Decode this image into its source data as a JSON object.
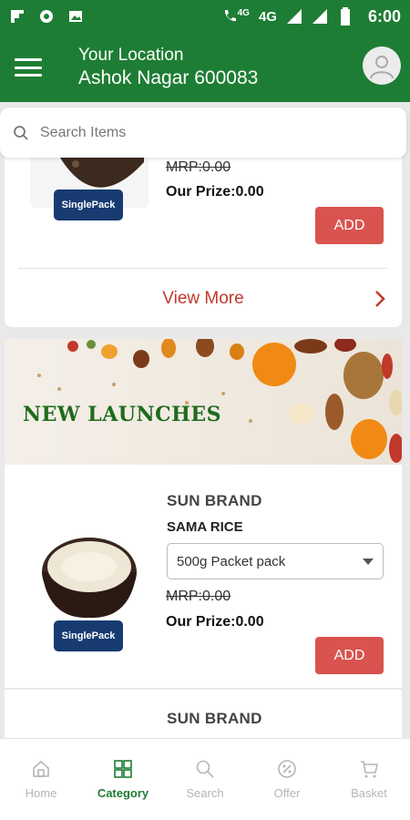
{
  "status_bar": {
    "network_label": "4G",
    "network_label_small": "4G",
    "time": "6:00"
  },
  "header": {
    "location_title": "Your Location",
    "location_name": "Ashok Nagar 600083"
  },
  "search": {
    "placeholder": "Search Items"
  },
  "card_top": {
    "pack_label": "SinglePack",
    "mrp": "MRP:0.00",
    "prize": "Our Prize:0.00",
    "add_label": "ADD",
    "view_more": "View More"
  },
  "banner": {
    "title": "NEW LAUNCHES"
  },
  "card_product": {
    "brand": "SUN BRAND",
    "name": "SAMA RICE",
    "variant": "500g Packet pack",
    "pack_label": "SinglePack",
    "mrp": "MRP:0.00",
    "prize": "Our Prize:0.00",
    "add_label": "ADD"
  },
  "card_next": {
    "brand": "SUN BRAND"
  },
  "bottom_nav": {
    "items": [
      {
        "label": "Home",
        "icon": "home-icon"
      },
      {
        "label": "Category",
        "icon": "category-icon"
      },
      {
        "label": "Search",
        "icon": "search-icon"
      },
      {
        "label": "Offer",
        "icon": "offer-icon"
      },
      {
        "label": "Basket",
        "icon": "basket-icon"
      }
    ],
    "active_index": 1
  },
  "colors": {
    "primary": "#1e7d34",
    "add_button": "#d9534f",
    "view_more": "#c0392b",
    "badge": "#173b71"
  }
}
